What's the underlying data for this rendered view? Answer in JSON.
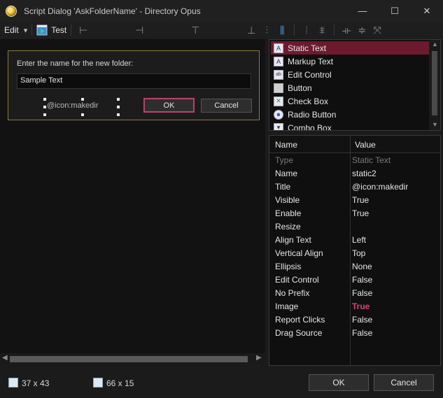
{
  "window": {
    "title": "Script Dialog 'AskFolderName' - Directory Opus",
    "minimize_glyph": "—",
    "maximize_glyph": "☐",
    "close_glyph": "✕"
  },
  "toolbar": {
    "edit_label": "Edit",
    "edit_arrow": "▾",
    "test_label": "Test",
    "glyphs": [
      "⊢",
      "⊣",
      "⊤",
      "⊥",
      "⫶",
      "⫼",
      "⦙",
      "⩨",
      "⟛",
      "≑",
      "⤧"
    ]
  },
  "dialog_preview": {
    "prompt_label": "Enter the name for the new folder:",
    "input_value": "Sample Text",
    "static_title": "@icon:makedir",
    "ok_label": "OK",
    "cancel_label": "Cancel"
  },
  "palette": {
    "items": [
      {
        "label": "Static Text",
        "icon": "static-text-icon",
        "glyph": "A"
      },
      {
        "label": "Markup Text",
        "icon": "markup-text-icon",
        "glyph": "A"
      },
      {
        "label": "Edit Control",
        "icon": "edit-control-icon",
        "glyph": "ab"
      },
      {
        "label": "Button",
        "icon": "button-icon",
        "glyph": ""
      },
      {
        "label": "Check Box",
        "icon": "check-box-icon",
        "glyph": "✕"
      },
      {
        "label": "Radio Button",
        "icon": "radio-button-icon",
        "glyph": "●"
      },
      {
        "label": "Combo Box",
        "icon": "combo-box-icon",
        "glyph": "▾"
      }
    ],
    "selected_index": 0
  },
  "properties": {
    "header_name": "Name",
    "header_value": "Value",
    "rows": [
      {
        "name": "Type",
        "value": "Static Text"
      },
      {
        "name": "Name",
        "value": "static2"
      },
      {
        "name": "Title",
        "value": "@icon:makedir"
      },
      {
        "name": "Visible",
        "value": "True"
      },
      {
        "name": "Enable",
        "value": "True"
      },
      {
        "name": "Resize",
        "value": ""
      },
      {
        "name": "Align Text",
        "value": "Left"
      },
      {
        "name": "Vertical Align",
        "value": "Top"
      },
      {
        "name": "Ellipsis",
        "value": "None"
      },
      {
        "name": "Edit Control",
        "value": "False"
      },
      {
        "name": "No Prefix",
        "value": "False"
      },
      {
        "name": "Image",
        "value": "True"
      },
      {
        "name": "Report Clicks",
        "value": "False"
      },
      {
        "name": "Drag Source",
        "value": "False"
      }
    ]
  },
  "footer": {
    "position_text": "37 x 43",
    "size_text": "66 x 15",
    "ok_label": "OK",
    "cancel_label": "Cancel"
  },
  "colors": {
    "accent_selection": "#6e1a2e",
    "highlight_value": "#e0407a",
    "dialog_border": "#8a7a40"
  }
}
